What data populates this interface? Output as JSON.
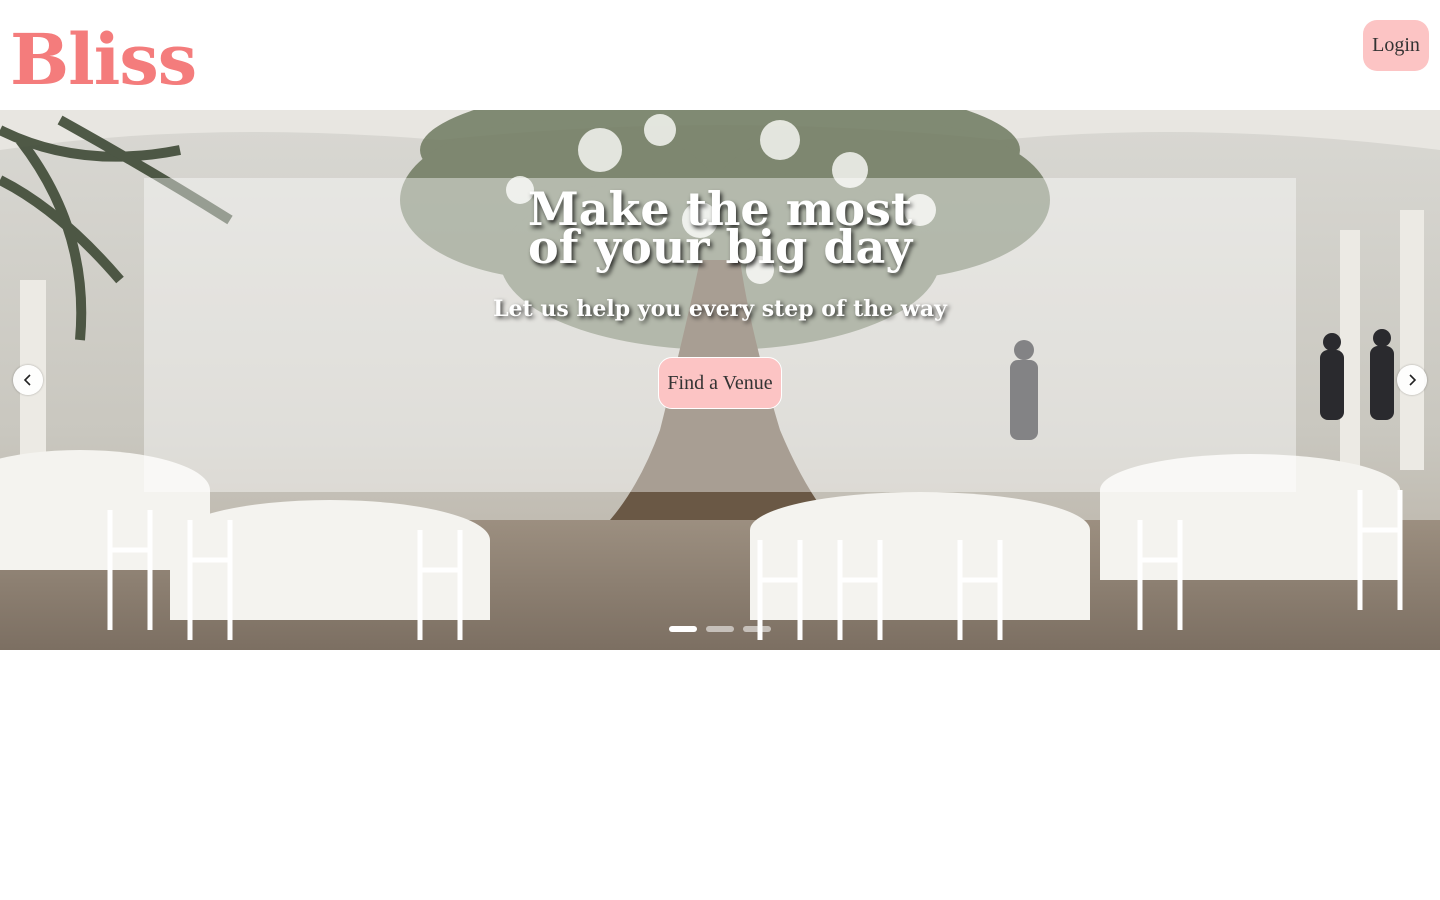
{
  "header": {
    "logo_text": "Bliss",
    "login_label": "Login"
  },
  "hero": {
    "title_line1": "Make the most",
    "title_line2": "of your big day",
    "subtitle": "Let us help you every step of the way",
    "cta_label": "Find a Venue",
    "prev_icon": "chevron-left-icon",
    "next_icon": "chevron-right-icon",
    "slide_count": 3,
    "active_slide": 1
  },
  "colors": {
    "brand": "#f47c7c",
    "button": "#fcc4c4",
    "button_text": "#333333"
  }
}
